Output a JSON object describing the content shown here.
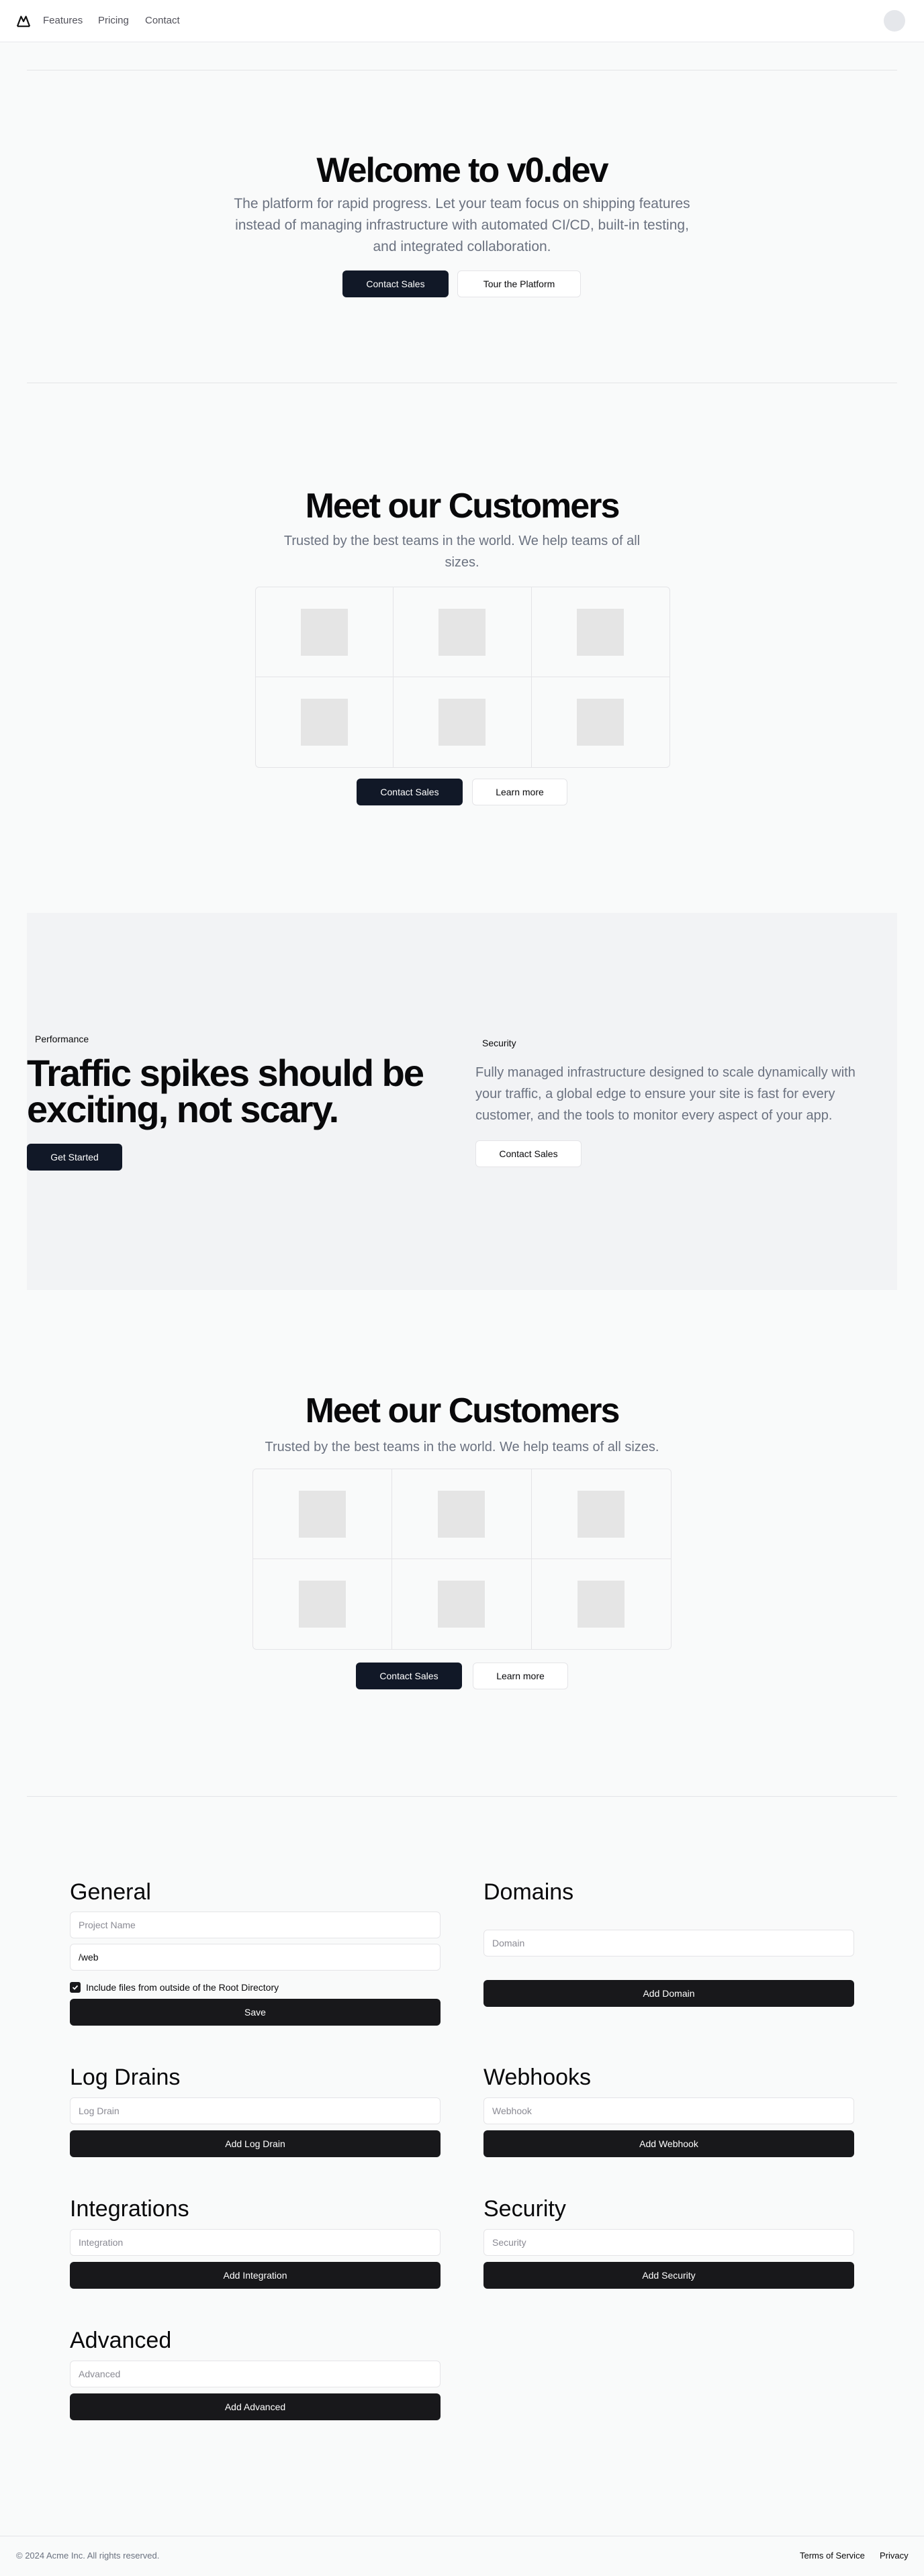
{
  "header": {
    "nav": [
      "Features",
      "Pricing",
      "Contact"
    ]
  },
  "hero": {
    "title": "Welcome to v0.dev",
    "subtitle_lines": [
      "The platform for rapid progress. Let your team focus on shipping features",
      "instead of managing infrastructure with automated CI/CD, built-in testing,",
      "and integrated collaboration."
    ],
    "primary_button": "Contact Sales",
    "secondary_button": "Tour the Platform"
  },
  "customers1": {
    "title": "Meet our Customers",
    "subtitle_lines": [
      "Trusted by the best teams in the world. We help teams of all",
      "sizes."
    ],
    "primary_button": "Contact Sales",
    "secondary_button": "Learn more"
  },
  "performance": {
    "tag": "Performance",
    "headline_lines": [
      "Traffic spikes should be",
      "exciting, not scary."
    ],
    "cta": "Get Started",
    "security_tag": "Security",
    "description_lines": [
      "Fully managed infrastructure designed to scale dynamically with",
      "your traffic, a global edge to ensure your site is fast for every",
      "customer, and the tools to monitor every aspect of your app."
    ],
    "security_button": "Contact Sales"
  },
  "customers2": {
    "title": "Meet our Customers",
    "subtitle": "Trusted by the best teams in the world. We help teams of all sizes.",
    "primary_button": "Contact Sales",
    "secondary_button": "Learn more"
  },
  "settings": {
    "general": {
      "title": "General",
      "project_placeholder": "Project Name",
      "directory_value": "/web",
      "checkbox_label": "Include files from outside of the Root Directory",
      "checkbox_checked": true,
      "save": "Save"
    },
    "domains": {
      "title": "Domains",
      "placeholder": "Domain",
      "button": "Add Domain"
    },
    "log_drains": {
      "title": "Log Drains",
      "placeholder": "Log Drain",
      "button": "Add Log Drain"
    },
    "webhooks": {
      "title": "Webhooks",
      "placeholder": "Webhook",
      "button": "Add Webhook"
    },
    "integrations": {
      "title": "Integrations",
      "placeholder": "Integration",
      "button": "Add Integration"
    },
    "security": {
      "title": "Security",
      "placeholder": "Security",
      "button": "Add Security"
    },
    "advanced": {
      "title": "Advanced",
      "placeholder": "Advanced",
      "button": "Add Advanced"
    }
  },
  "footer": {
    "copyright": "© 2024 Acme Inc. All rights reserved.",
    "links": [
      "Terms of Service",
      "Privacy"
    ]
  },
  "colors": {
    "primary_button": "#111827",
    "block_button": "#18181b",
    "page_background": "#f9fafa",
    "band_background": "#f2f3f5",
    "muted_text": "#6b7280"
  },
  "icons": {
    "logo": "mountain-logo-icon",
    "placeholder": "image-placeholder-icon",
    "checkbox": "check-icon"
  }
}
